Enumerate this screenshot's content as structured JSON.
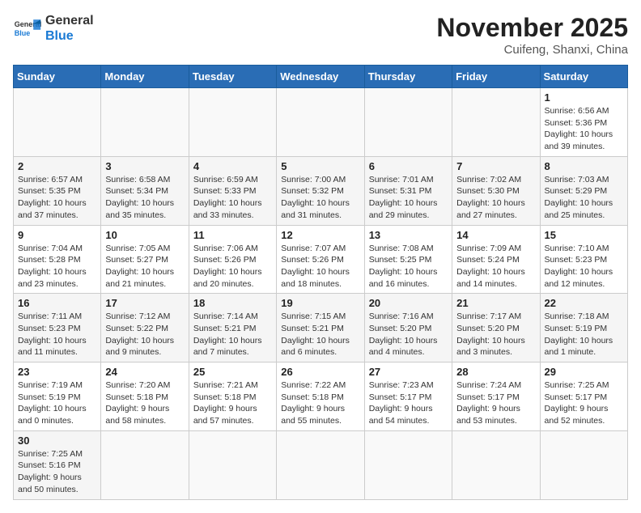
{
  "header": {
    "logo_general": "General",
    "logo_blue": "Blue",
    "month_title": "November 2025",
    "subtitle": "Cuifeng, Shanxi, China"
  },
  "days_of_week": [
    "Sunday",
    "Monday",
    "Tuesday",
    "Wednesday",
    "Thursday",
    "Friday",
    "Saturday"
  ],
  "weeks": [
    [
      {
        "day": "",
        "info": ""
      },
      {
        "day": "",
        "info": ""
      },
      {
        "day": "",
        "info": ""
      },
      {
        "day": "",
        "info": ""
      },
      {
        "day": "",
        "info": ""
      },
      {
        "day": "",
        "info": ""
      },
      {
        "day": "1",
        "info": "Sunrise: 6:56 AM\nSunset: 5:36 PM\nDaylight: 10 hours\nand 39 minutes."
      }
    ],
    [
      {
        "day": "2",
        "info": "Sunrise: 6:57 AM\nSunset: 5:35 PM\nDaylight: 10 hours\nand 37 minutes."
      },
      {
        "day": "3",
        "info": "Sunrise: 6:58 AM\nSunset: 5:34 PM\nDaylight: 10 hours\nand 35 minutes."
      },
      {
        "day": "4",
        "info": "Sunrise: 6:59 AM\nSunset: 5:33 PM\nDaylight: 10 hours\nand 33 minutes."
      },
      {
        "day": "5",
        "info": "Sunrise: 7:00 AM\nSunset: 5:32 PM\nDaylight: 10 hours\nand 31 minutes."
      },
      {
        "day": "6",
        "info": "Sunrise: 7:01 AM\nSunset: 5:31 PM\nDaylight: 10 hours\nand 29 minutes."
      },
      {
        "day": "7",
        "info": "Sunrise: 7:02 AM\nSunset: 5:30 PM\nDaylight: 10 hours\nand 27 minutes."
      },
      {
        "day": "8",
        "info": "Sunrise: 7:03 AM\nSunset: 5:29 PM\nDaylight: 10 hours\nand 25 minutes."
      }
    ],
    [
      {
        "day": "9",
        "info": "Sunrise: 7:04 AM\nSunset: 5:28 PM\nDaylight: 10 hours\nand 23 minutes."
      },
      {
        "day": "10",
        "info": "Sunrise: 7:05 AM\nSunset: 5:27 PM\nDaylight: 10 hours\nand 21 minutes."
      },
      {
        "day": "11",
        "info": "Sunrise: 7:06 AM\nSunset: 5:26 PM\nDaylight: 10 hours\nand 20 minutes."
      },
      {
        "day": "12",
        "info": "Sunrise: 7:07 AM\nSunset: 5:26 PM\nDaylight: 10 hours\nand 18 minutes."
      },
      {
        "day": "13",
        "info": "Sunrise: 7:08 AM\nSunset: 5:25 PM\nDaylight: 10 hours\nand 16 minutes."
      },
      {
        "day": "14",
        "info": "Sunrise: 7:09 AM\nSunset: 5:24 PM\nDaylight: 10 hours\nand 14 minutes."
      },
      {
        "day": "15",
        "info": "Sunrise: 7:10 AM\nSunset: 5:23 PM\nDaylight: 10 hours\nand 12 minutes."
      }
    ],
    [
      {
        "day": "16",
        "info": "Sunrise: 7:11 AM\nSunset: 5:23 PM\nDaylight: 10 hours\nand 11 minutes."
      },
      {
        "day": "17",
        "info": "Sunrise: 7:12 AM\nSunset: 5:22 PM\nDaylight: 10 hours\nand 9 minutes."
      },
      {
        "day": "18",
        "info": "Sunrise: 7:14 AM\nSunset: 5:21 PM\nDaylight: 10 hours\nand 7 minutes."
      },
      {
        "day": "19",
        "info": "Sunrise: 7:15 AM\nSunset: 5:21 PM\nDaylight: 10 hours\nand 6 minutes."
      },
      {
        "day": "20",
        "info": "Sunrise: 7:16 AM\nSunset: 5:20 PM\nDaylight: 10 hours\nand 4 minutes."
      },
      {
        "day": "21",
        "info": "Sunrise: 7:17 AM\nSunset: 5:20 PM\nDaylight: 10 hours\nand 3 minutes."
      },
      {
        "day": "22",
        "info": "Sunrise: 7:18 AM\nSunset: 5:19 PM\nDaylight: 10 hours\nand 1 minute."
      }
    ],
    [
      {
        "day": "23",
        "info": "Sunrise: 7:19 AM\nSunset: 5:19 PM\nDaylight: 10 hours\nand 0 minutes."
      },
      {
        "day": "24",
        "info": "Sunrise: 7:20 AM\nSunset: 5:18 PM\nDaylight: 9 hours\nand 58 minutes."
      },
      {
        "day": "25",
        "info": "Sunrise: 7:21 AM\nSunset: 5:18 PM\nDaylight: 9 hours\nand 57 minutes."
      },
      {
        "day": "26",
        "info": "Sunrise: 7:22 AM\nSunset: 5:18 PM\nDaylight: 9 hours\nand 55 minutes."
      },
      {
        "day": "27",
        "info": "Sunrise: 7:23 AM\nSunset: 5:17 PM\nDaylight: 9 hours\nand 54 minutes."
      },
      {
        "day": "28",
        "info": "Sunrise: 7:24 AM\nSunset: 5:17 PM\nDaylight: 9 hours\nand 53 minutes."
      },
      {
        "day": "29",
        "info": "Sunrise: 7:25 AM\nSunset: 5:17 PM\nDaylight: 9 hours\nand 52 minutes."
      }
    ],
    [
      {
        "day": "30",
        "info": "Sunrise: 7:25 AM\nSunset: 5:16 PM\nDaylight: 9 hours\nand 50 minutes."
      },
      {
        "day": "",
        "info": ""
      },
      {
        "day": "",
        "info": ""
      },
      {
        "day": "",
        "info": ""
      },
      {
        "day": "",
        "info": ""
      },
      {
        "day": "",
        "info": ""
      },
      {
        "day": "",
        "info": ""
      }
    ]
  ]
}
